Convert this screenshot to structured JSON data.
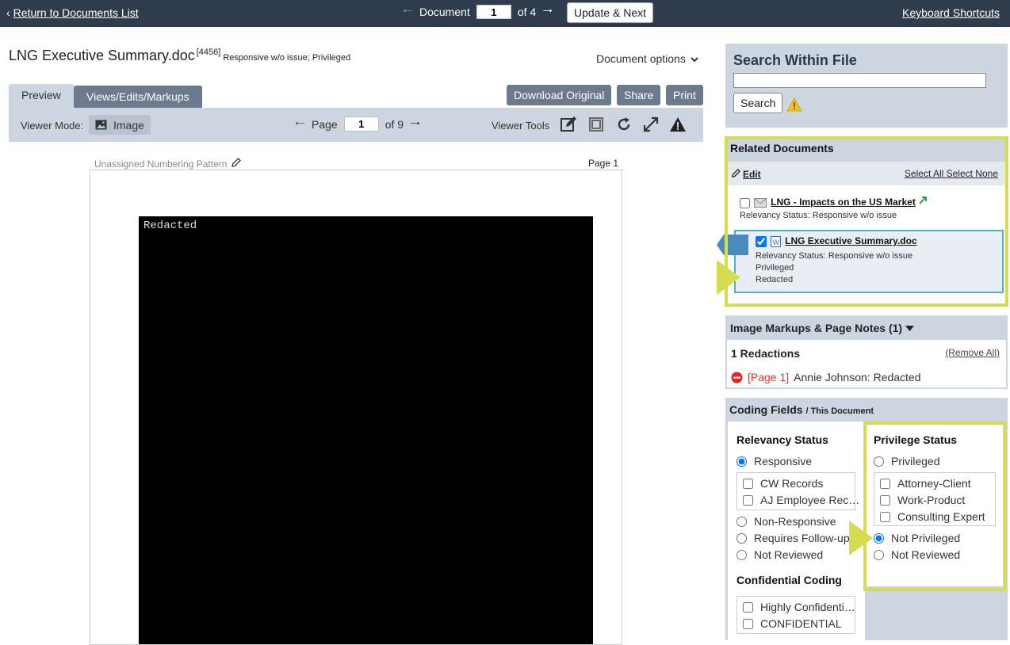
{
  "topbar": {
    "back_label": "Return to Documents List",
    "doc_label": "Document",
    "doc_number": "1",
    "doc_total": "of 4",
    "update_next": "Update & Next",
    "keyboard_shortcuts": "Keyboard Shortcuts"
  },
  "document": {
    "title": "LNG Executive Summary.doc",
    "id": "[4456]",
    "status": "Responsive w/o issue; Privileged",
    "options_label": "Document options"
  },
  "tabs": {
    "preview": "Preview",
    "views": "Views/Edits/Markups"
  },
  "actions": {
    "download": "Download Original",
    "share": "Share",
    "print": "Print"
  },
  "viewer": {
    "mode_label": "Viewer Mode:",
    "mode_value": "Image",
    "page_label": "Page",
    "page_number": "1",
    "page_total": "of 9",
    "tools_label": "Viewer Tools"
  },
  "page": {
    "numbering_pattern": "Unassigned Numbering Pattern",
    "page_label": "Page 1",
    "redacted_text": "Redacted"
  },
  "search": {
    "title": "Search Within File",
    "query": "",
    "button": "Search"
  },
  "related": {
    "title": "Related Documents",
    "edit": "Edit",
    "select_all": "Select All",
    "select_none": "Select None",
    "items": [
      {
        "name": "LNG - Impacts on the US Market",
        "status": "Relevancy Status: Responsive w/o issue",
        "checked": false
      },
      {
        "name": "LNG Executive Summary.doc",
        "status": "Relevancy Status: Responsive w/o issue",
        "tag1": "Privileged",
        "tag2": "Redacted",
        "checked": true
      }
    ]
  },
  "markups": {
    "title": "Image Markups & Page Notes (1)",
    "count": "1 Redactions",
    "remove_all": "(Remove All)",
    "item_page": "[Page 1]",
    "item_text": "Annie Johnson: Redacted"
  },
  "coding": {
    "title": "Coding Fields",
    "subtitle": "/ This Document",
    "relevancy": {
      "title": "Relevancy Status",
      "responsive": "Responsive",
      "sub": [
        "CW Records",
        "AJ Employee Rec…"
      ],
      "non_responsive": "Non-Responsive",
      "follow_up": "Requires Follow-up",
      "not_reviewed": "Not Reviewed"
    },
    "confidential": {
      "title": "Confidential Coding",
      "options": [
        "Highly Confidenti…",
        "CONFIDENTIAL"
      ]
    },
    "privilege": {
      "title": "Privilege Status",
      "privileged": "Privileged",
      "sub": [
        "Attorney-Client",
        "Work-Product",
        "Consulting Expert"
      ],
      "not_privileged": "Not Privileged",
      "not_reviewed": "Not Reviewed"
    }
  },
  "colors": {
    "topbar": "#2f3c4e",
    "panel": "#cdd6e0",
    "highlight": "#d6dc4f",
    "accent": "#4ab3c4"
  }
}
